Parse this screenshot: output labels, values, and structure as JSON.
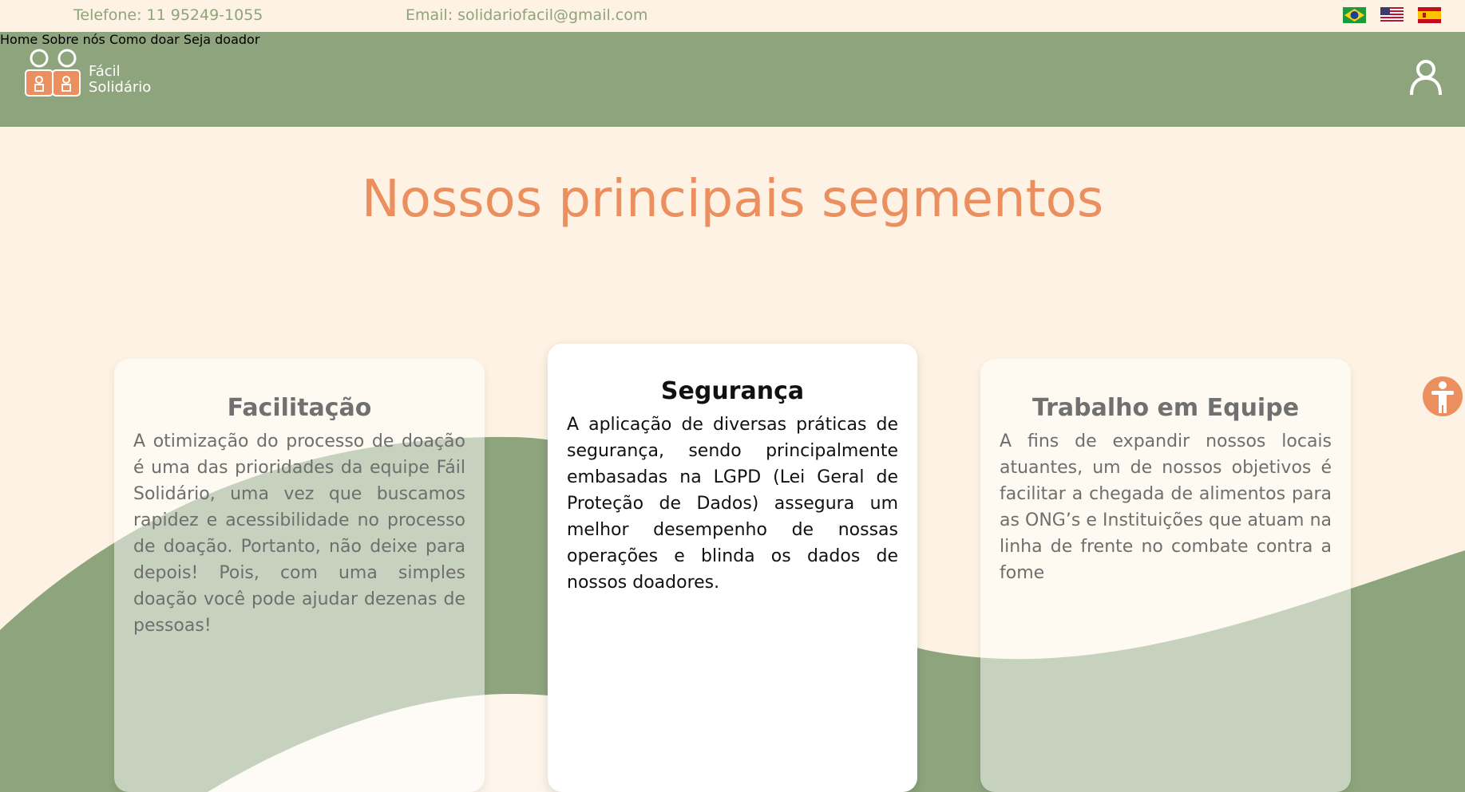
{
  "topbar": {
    "phone": "Telefone: 11 95249-1055",
    "email": "Email: solidariofacil@gmail.com",
    "flags": [
      "brazil-flag",
      "usa-flag",
      "spain-flag"
    ]
  },
  "brand": {
    "line1": "Fácil",
    "line2": "Solidário"
  },
  "nav": {
    "items": [
      "Home",
      "Sobre nós",
      "Como doar",
      "Seja doador"
    ]
  },
  "main": {
    "heading": "Nossos principais segmentos",
    "cards": [
      {
        "title": "Facilitação",
        "text": "A otimização do processo de doação é uma das prioridades da equipe Fáil Solidário, uma vez que buscamos rapidez e acessibilidade no processo de doação. Portanto, não deixe para depois! Pois, com uma simples doação você pode ajudar dezenas de pessoas!"
      },
      {
        "title": "Segurança",
        "text": "A aplicação de diversas práticas de segurança, sendo principalmente embasadas na LGPD (Lei Geral de Proteção de Dados) assegura um melhor desempenho de nossas operações e blinda os dados de nossos doadores."
      },
      {
        "title": "Trabalho em Equipe",
        "text": "A fins de expandir nossos locais atuantes, um de nossos objetivos é facilitar a chegada de alimentos para as ONG’s e Instituições que atuam na linha de frente no combate contra a fome"
      }
    ]
  },
  "colors": {
    "green": "#8da47c",
    "cream": "#fdf2e3",
    "orange": "#eb8f5e"
  }
}
